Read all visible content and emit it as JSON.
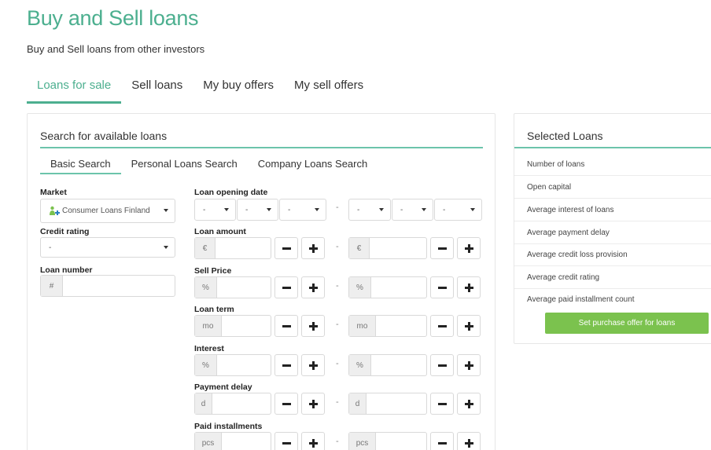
{
  "page": {
    "title": "Buy and Sell loans",
    "subtitle": "Buy and Sell loans from other investors"
  },
  "main_tabs": [
    {
      "label": "Loans for sale",
      "active": true
    },
    {
      "label": "Sell loans",
      "active": false
    },
    {
      "label": "My buy offers",
      "active": false
    },
    {
      "label": "My sell offers",
      "active": false
    }
  ],
  "search": {
    "title": "Search for available loans",
    "sub_tabs": [
      {
        "label": "Basic Search",
        "active": true
      },
      {
        "label": "Personal Loans Search",
        "active": false
      },
      {
        "label": "Company Loans Search",
        "active": false
      }
    ],
    "market": {
      "label": "Market",
      "value": "Consumer Loans Finland",
      "icon": "consumer-loans-icon"
    },
    "credit_rating": {
      "label": "Credit rating",
      "value": "-"
    },
    "loan_number": {
      "label": "Loan number",
      "prefix": "#"
    },
    "loan_opening_date": {
      "label": "Loan opening date",
      "placeholder": "-"
    },
    "range_separator": "-",
    "ranges": [
      {
        "label": "Loan amount",
        "unit": "€"
      },
      {
        "label": "Sell Price",
        "unit": "%"
      },
      {
        "label": "Loan term",
        "unit": "mo"
      },
      {
        "label": "Interest",
        "unit": "%"
      },
      {
        "label": "Payment delay",
        "unit": "d"
      },
      {
        "label": "Paid installments",
        "unit": "pcs"
      }
    ]
  },
  "selected": {
    "title": "Selected Loans",
    "rows": [
      "Number of loans",
      "Open capital",
      "Average interest of loans",
      "Average payment delay",
      "Average credit loss provision",
      "Average credit rating",
      "Average paid installment count"
    ],
    "button_label": "Set purchase offer for loans"
  },
  "colors": {
    "accent": "#4caf8f",
    "underline": "#6cc4ab",
    "button_green": "#7bc24e"
  }
}
